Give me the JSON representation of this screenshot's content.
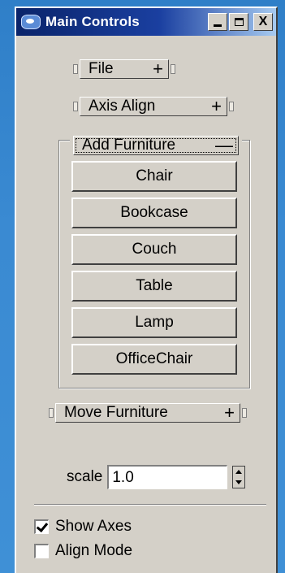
{
  "window": {
    "title": "Main Controls",
    "title_buttons": {
      "minimize": "_",
      "maximize": "□",
      "close": "X"
    }
  },
  "rollouts": {
    "file": {
      "label": "File",
      "state": "+"
    },
    "axis_align": {
      "label": "Axis Align",
      "state": "+"
    },
    "add_furniture": {
      "label": "Add Furniture",
      "state": "—"
    },
    "move_furniture": {
      "label": "Move Furniture",
      "state": "+"
    }
  },
  "furniture_buttons": [
    "Chair",
    "Bookcase",
    "Couch",
    "Table",
    "Lamp",
    "OfficeChair"
  ],
  "scale": {
    "label": "scale",
    "value": "1.0"
  },
  "checkboxes": {
    "show_axes": {
      "label": "Show Axes",
      "checked": true
    },
    "align_mode": {
      "label": "Align Mode",
      "checked": false
    }
  }
}
